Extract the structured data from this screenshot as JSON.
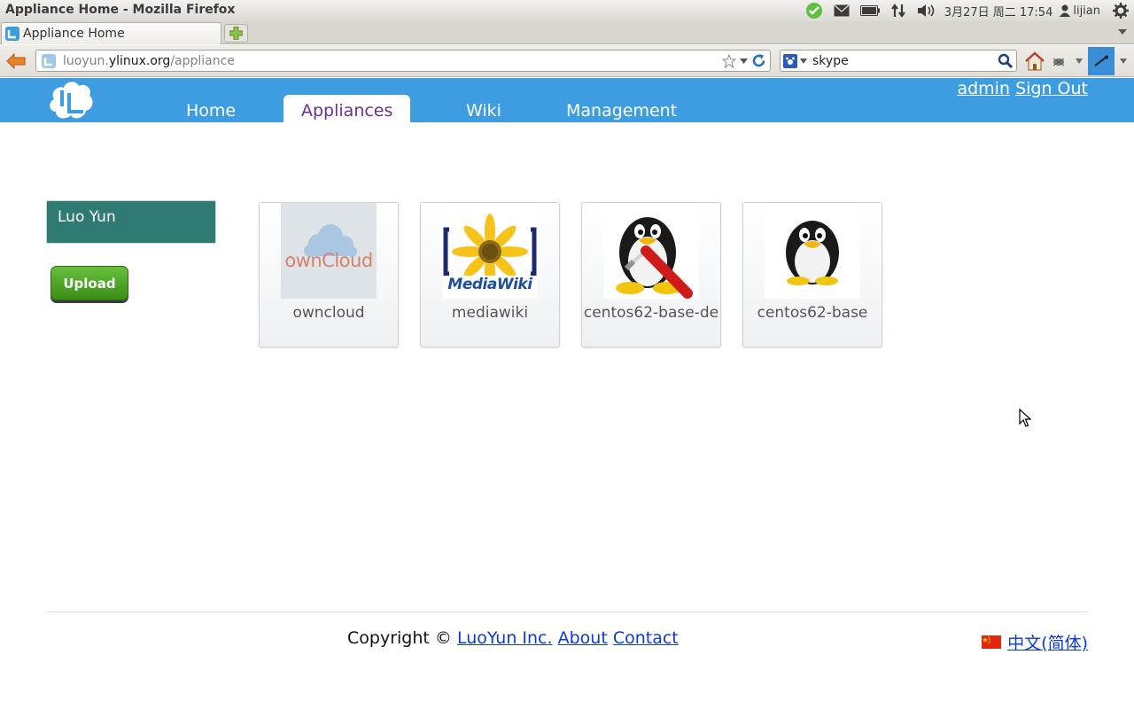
{
  "os_panel": {
    "window_title": "Appliance Home - Mozilla Firefox",
    "datetime": "3月27日 周二 17:54",
    "user": "lijian",
    "icons": [
      "chat-status-icon",
      "mail-icon",
      "battery-icon",
      "network-icon",
      "volume-icon",
      "user-icon",
      "power-gear-icon"
    ]
  },
  "browser": {
    "tab_title": "Appliance Home",
    "url": {
      "host_prefix": "luoyun.",
      "host": "ylinux.org",
      "path": "/appliance"
    },
    "search_value": "skype"
  },
  "site": {
    "nav": [
      {
        "label": "Home",
        "active": false
      },
      {
        "label": "Appliances",
        "active": true
      },
      {
        "label": "Wiki",
        "active": false
      },
      {
        "label": "Management",
        "active": false
      }
    ],
    "user_link": "admin",
    "signout_link": "Sign Out"
  },
  "sidebar": {
    "card_title": "Luo Yun",
    "upload_label": "Upload"
  },
  "appliances": [
    {
      "name": "owncloud",
      "thumb_text": "ownCloud"
    },
    {
      "name": "mediawiki",
      "thumb_text": "MediaWiki"
    },
    {
      "name": "centos62-base-de"
    },
    {
      "name": "centos62-base"
    }
  ],
  "footer": {
    "copyright": "Copyright ©",
    "company": "LuoYun Inc.",
    "about": "About",
    "contact": "Contact",
    "language": "中文(简体)"
  },
  "colors": {
    "header_blue": "#3e9de1",
    "active_tab_text": "#6a2f8f",
    "sidebar_teal": "#2f7a73",
    "upload_green": "#4fa524"
  }
}
